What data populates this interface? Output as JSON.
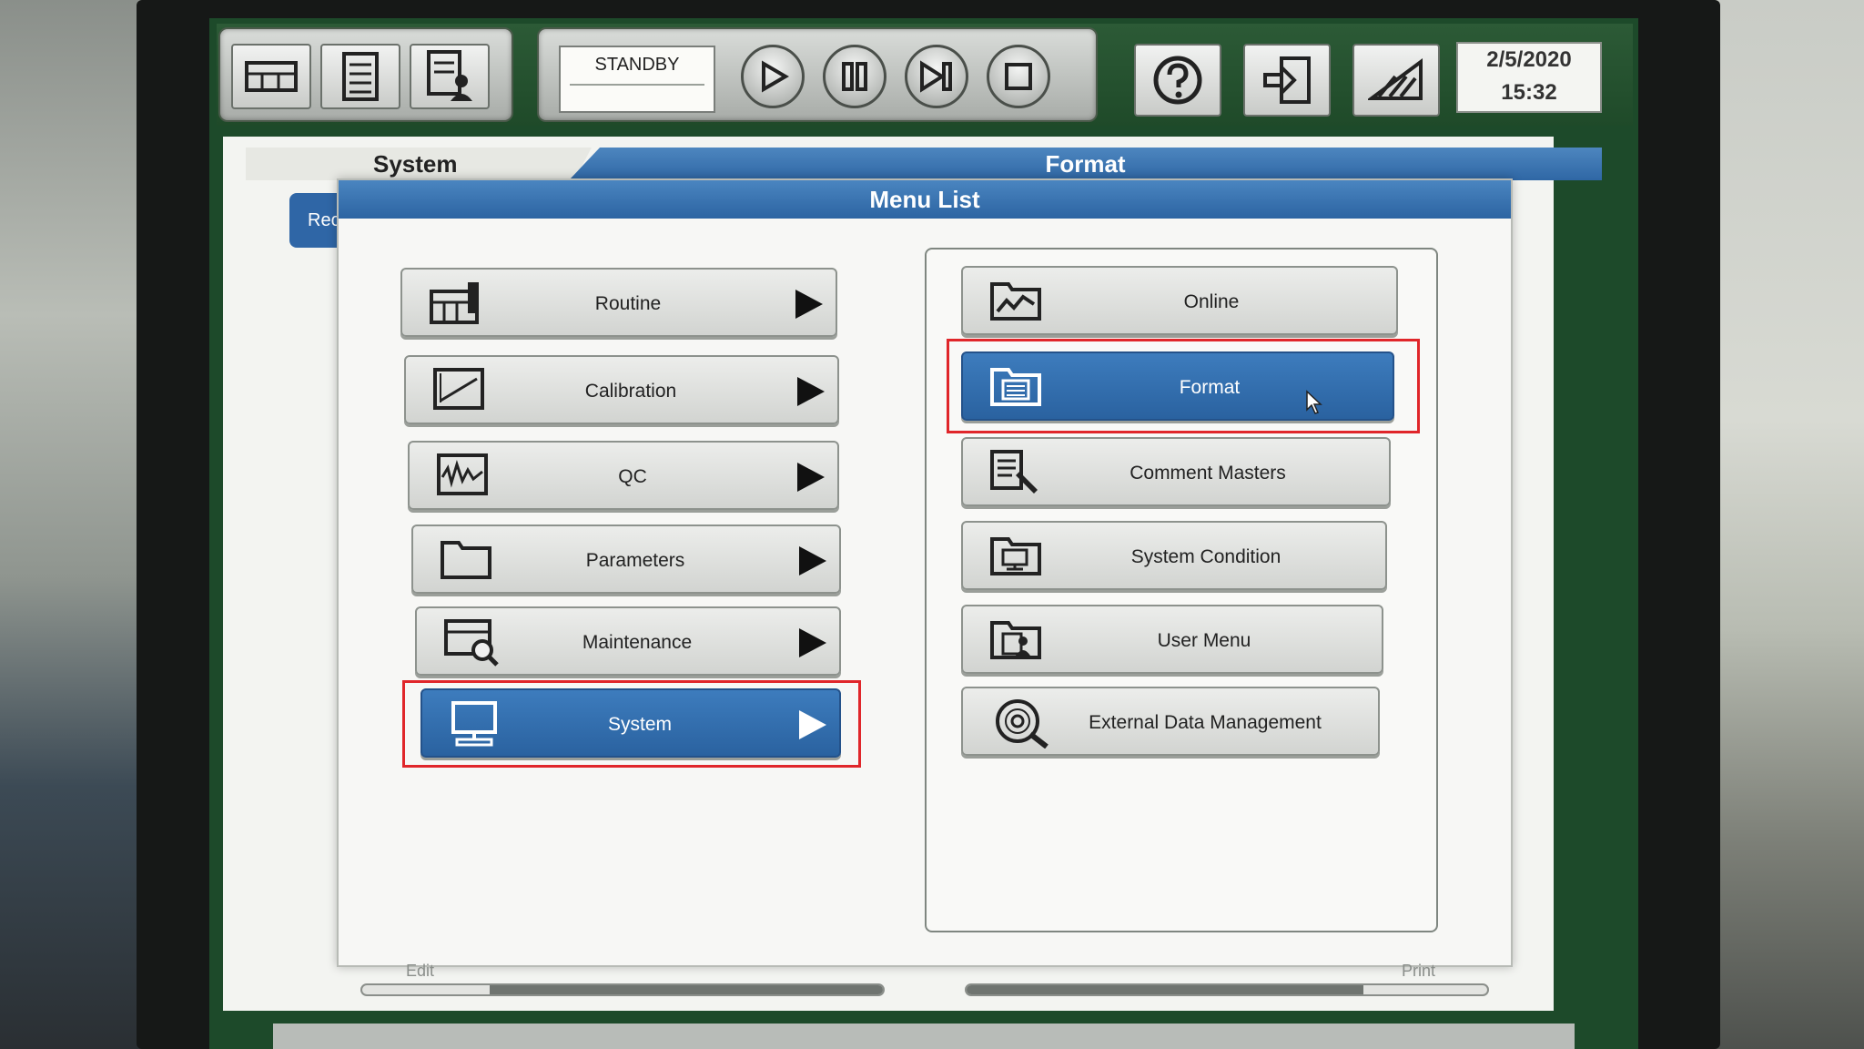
{
  "toolbar": {
    "status": "STANDBY",
    "date": "2/5/2020",
    "time": "15:32",
    "icons": [
      "rack-icon",
      "list-icon",
      "user-list-icon",
      "start-icon",
      "pause-icon",
      "step-icon",
      "stop-icon",
      "help-icon",
      "logout-icon",
      "shutdown-icon"
    ]
  },
  "tabs": {
    "left": "System",
    "right": "Format"
  },
  "side_button": "Rec",
  "dialog": {
    "title": "Menu List",
    "left_menu": [
      {
        "label": "Routine",
        "icon": "routine-icon",
        "selected": false
      },
      {
        "label": "Calibration",
        "icon": "calibration-icon",
        "selected": false
      },
      {
        "label": "QC",
        "icon": "qc-icon",
        "selected": false
      },
      {
        "label": "Parameters",
        "icon": "folder-icon",
        "selected": false
      },
      {
        "label": "Maintenance",
        "icon": "maintenance-icon",
        "selected": false
      },
      {
        "label": "System",
        "icon": "monitor-icon",
        "selected": true
      }
    ],
    "right_menu": [
      {
        "label": "Online",
        "icon": "online-icon",
        "selected": false
      },
      {
        "label": "Format",
        "icon": "format-icon",
        "selected": true
      },
      {
        "label": "Comment Masters",
        "icon": "comment-icon",
        "selected": false
      },
      {
        "label": "System Condition",
        "icon": "system-condition-icon",
        "selected": false
      },
      {
        "label": "User Menu",
        "icon": "user-menu-icon",
        "selected": false
      },
      {
        "label": "External Data Management",
        "icon": "disc-search-icon",
        "selected": false
      }
    ]
  },
  "footer": {
    "edit": "Edit",
    "print": "Print"
  },
  "colors": {
    "accent_blue": "#2f67a5",
    "highlight_red": "#e0262a",
    "frame_green": "#1f4a29"
  }
}
